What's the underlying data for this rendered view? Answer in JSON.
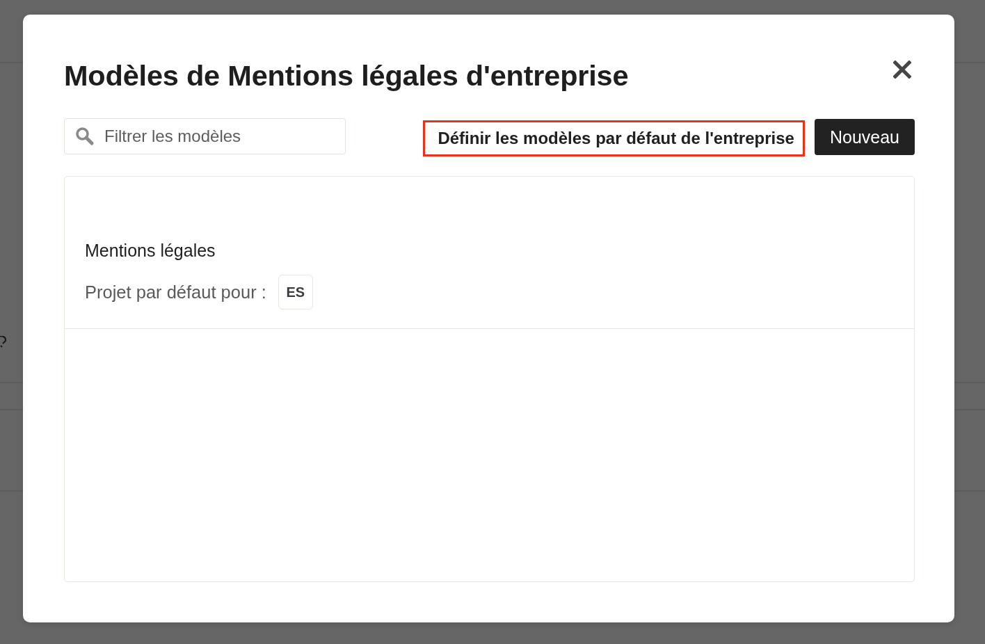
{
  "dialog": {
    "title": "Modèles de Mentions légales d'entreprise"
  },
  "search": {
    "placeholder": "Filtrer les modèles"
  },
  "actions": [
    {
      "label": "Définir les modèles par défaut de l'entreprise",
      "kind": "outline",
      "highlighted": true
    },
    {
      "label": "Nouveau",
      "kind": "primary",
      "highlighted": false
    }
  ],
  "templates": [
    {
      "name": "Mentions légales",
      "default_label": "Projet par défaut pour :",
      "languages": [
        "ES"
      ]
    }
  ]
}
